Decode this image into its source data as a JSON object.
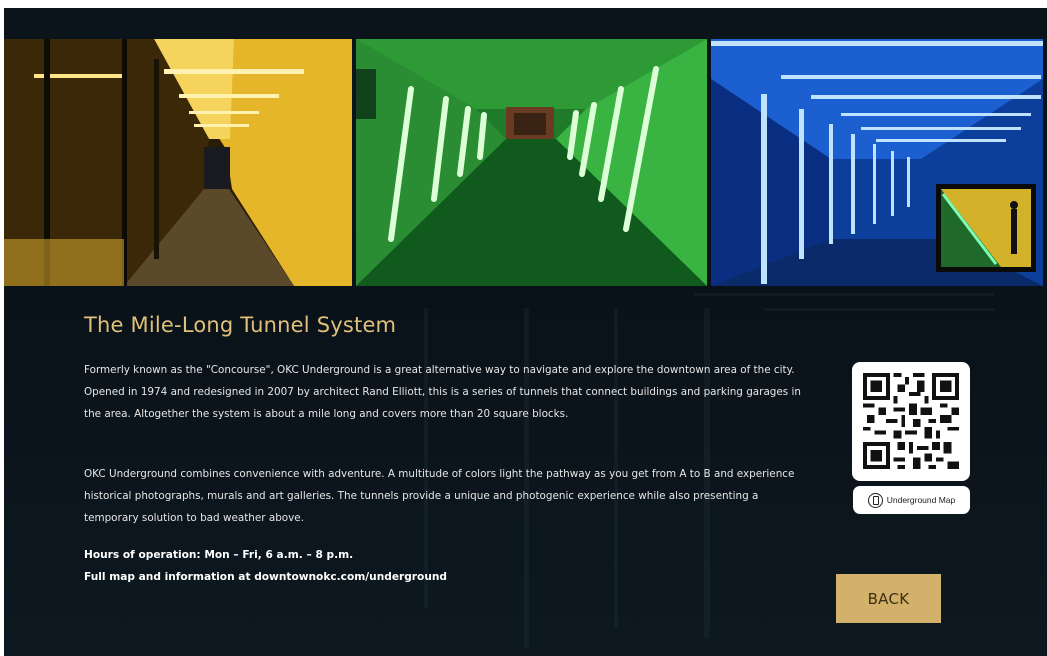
{
  "photos": [
    {
      "name": "yellow-tunnel",
      "accent": "#f2c12e"
    },
    {
      "name": "green-tunnel",
      "accent": "#4be05a"
    },
    {
      "name": "blue-tunnel",
      "accent": "#2f8cf5"
    }
  ],
  "content": {
    "title": "The Mile-Long Tunnel System",
    "paragraph_1": "Formerly known as the \"Concourse\", OKC Underground is a great alternative way to navigate and explore the downtown area of the city. Opened in 1974 and redesigned in 2007 by architect Rand Elliott, this is a series of tunnels that connect buildings and parking garages in the area. Altogether the system is about a mile long and covers more than 20 square blocks.",
    "paragraph_2": "OKC Underground combines convenience with adventure. A multitude of colors light the pathway as you get from A to B and experience historical photographs, murals and art galleries. The tunnels provide a unique and photogenic experience while also presenting a temporary solution to bad weather above.",
    "hours": "Hours of operation: Mon – Fri, 6 a.m. – 8 p.m.",
    "map_info": "Full map and information at downtownokc.com/underground"
  },
  "qr": {
    "label": "Underground Map",
    "icon": "phone-icon"
  },
  "navigation": {
    "back_label": "BACK"
  },
  "colors": {
    "title_gold": "#e0c07a",
    "button_gold": "#d4b16a",
    "background": "#0b141b"
  }
}
